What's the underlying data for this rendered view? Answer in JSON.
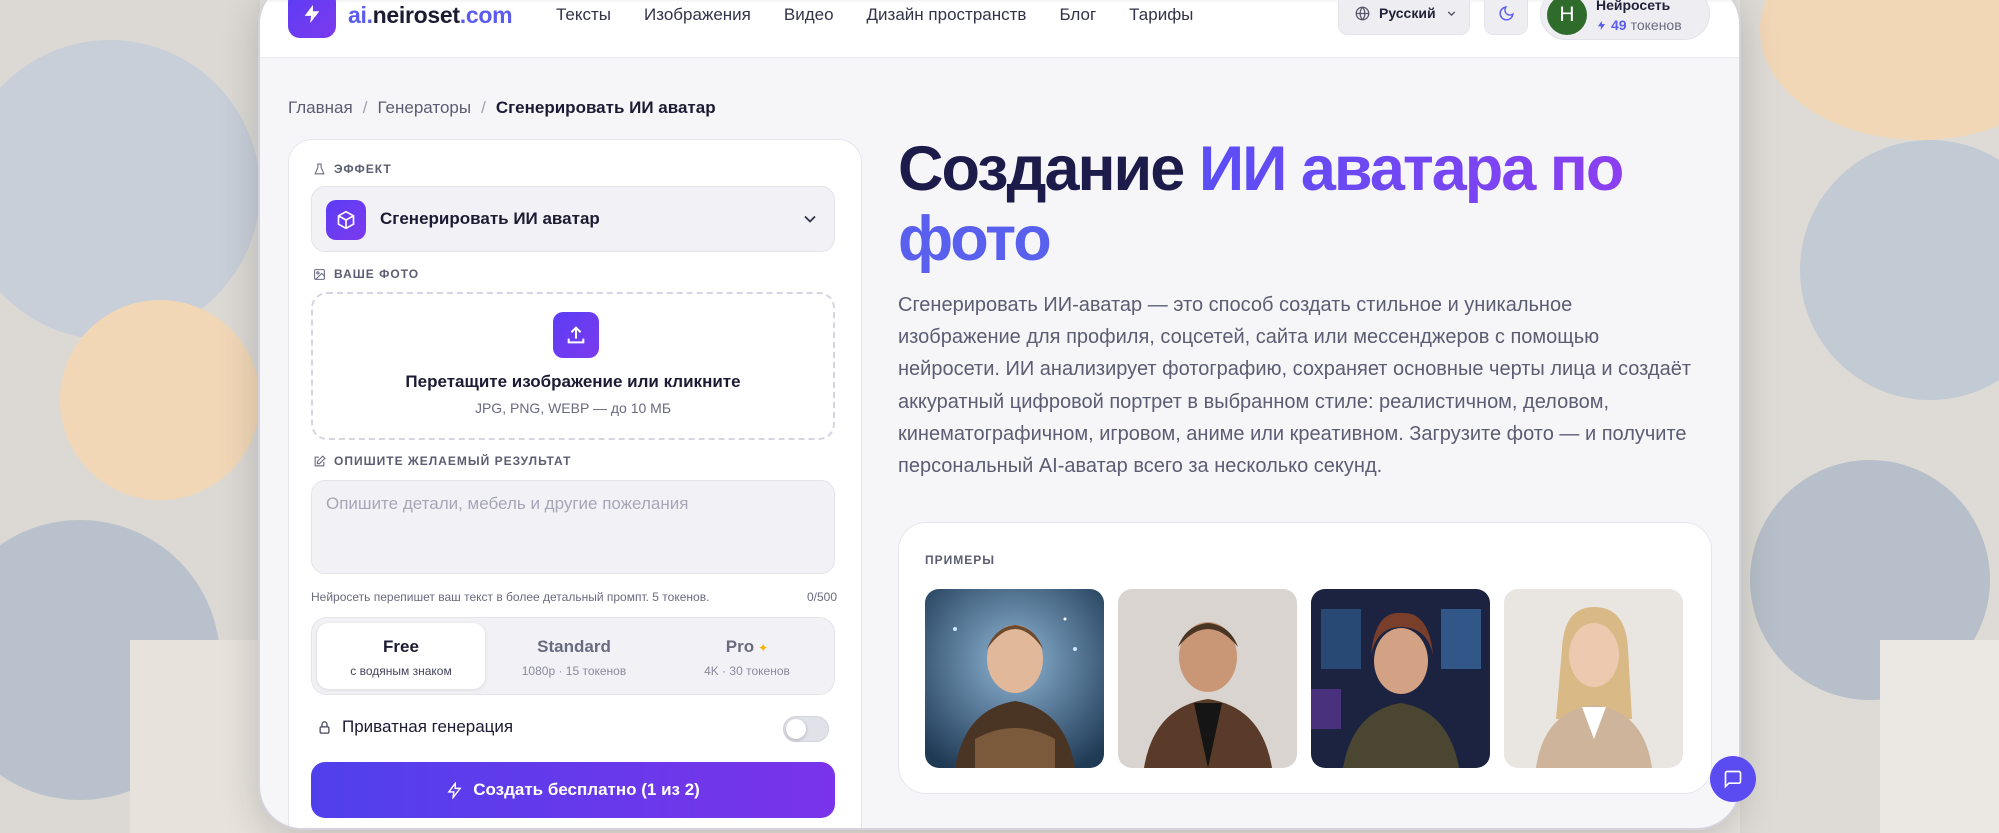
{
  "header": {
    "brand_prefix": "ai.",
    "brand_name": "neiroset",
    "brand_suffix": ".com",
    "nav": [
      "Тексты",
      "Изображения",
      "Видео",
      "Дизайн пространств",
      "Блог",
      "Тарифы"
    ],
    "language": "Русский",
    "user": {
      "initial": "Н",
      "name": "Нейросеть",
      "tokens": "49",
      "tokens_label": "токенов"
    }
  },
  "breadcrumb": {
    "home": "Главная",
    "section": "Генераторы",
    "current": "Сгенерировать ИИ аватар",
    "separator": "/"
  },
  "form": {
    "effect_label": "ЭФФЕКТ",
    "effect_value": "Сгенерировать ИИ аватар",
    "photo_label": "ВАШЕ ФОТО",
    "upload_title": "Перетащите изображение или кликните",
    "upload_formats": "JPG, PNG, WEBP — до 10 МБ",
    "prompt_label": "ОПИШИТЕ ЖЕЛАЕМЫЙ РЕЗУЛЬТАТ",
    "prompt_placeholder": "Опишите детали, мебель и другие пожелания",
    "prompt_value": "",
    "prompt_hint": "Нейросеть перепишет ваш текст в более детальный промпт. 5 токенов.",
    "prompt_count": "0/500",
    "tiers": [
      {
        "name": "Free",
        "sub": "с водяным знаком",
        "active": true
      },
      {
        "name": "Standard",
        "sub": "1080p · 15 токенов",
        "active": false
      },
      {
        "name": "Pro",
        "sub": "4K · 30 токенов",
        "active": false
      }
    ],
    "private_label": "Приватная генерация",
    "private_on": false,
    "cta": "Создать бесплатно (1 из 2)"
  },
  "hero": {
    "title_dark": "Создание",
    "title_gradient": "ИИ аватара по",
    "title_gradient2": "фото",
    "description": "Сгенерировать ИИ-аватар — это способ создать стильное и уникальное изображение для профиля, соцсетей, сайта или мессенджеров с помощью нейросети. ИИ анализирует фотографию, сохраняет основные черты лица и создаёт аккуратный цифровой портрет в выбранном стиле: реалистичном, деловом, кинематографичном, игровом, аниме или креативном. Загрузите фото — и получите персональный AI-аватар всего за несколько секунд."
  },
  "examples": {
    "label": "ПРИМЕРЫ",
    "items": [
      "fantasy-armor-portrait",
      "leather-jacket-portrait",
      "sci-fi-cyber-portrait",
      "business-blazer-portrait"
    ]
  },
  "colors": {
    "accent": "#5b3df5",
    "accent2": "#7c3aed",
    "cta_start": "#5040ec",
    "cta_end": "#7a33ea"
  }
}
